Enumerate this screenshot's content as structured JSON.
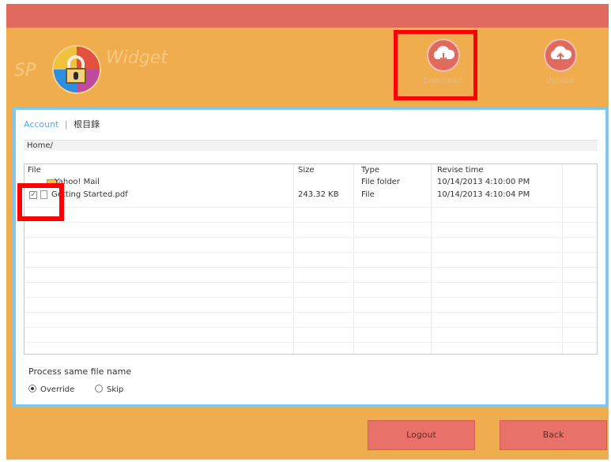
{
  "app": {
    "logo_left": "SP",
    "logo_right": "Widget"
  },
  "toolbar": {
    "download_label": "Download",
    "upload_label": "Upload"
  },
  "breadcrumb": {
    "root": "Account",
    "separator": "|",
    "current": "根目錄"
  },
  "path": "Home/",
  "table": {
    "columns": [
      "File",
      "Size",
      "Type",
      "Revise time"
    ],
    "rows": [
      {
        "name": "Yahoo! Mail",
        "size": "",
        "type": "File folder",
        "revise_time": "10/14/2013 4:10:00 PM",
        "checked": false,
        "icon": "folder-icon"
      },
      {
        "name": "Getting Started.pdf",
        "size": "243.32 KB",
        "type": "File",
        "revise_time": "10/14/2013 4:10:04 PM",
        "checked": true,
        "icon": "file-icon"
      }
    ]
  },
  "process": {
    "title": "Process same file name",
    "options": [
      {
        "label": "Override",
        "selected": true
      },
      {
        "label": "Skip",
        "selected": false
      }
    ]
  },
  "buttons": {
    "logout": "Logout",
    "back": "Back"
  },
  "colors": {
    "window_bg": "#f0ad4e",
    "titlebar": "#e06a5e",
    "panel_border": "#7fc7ee",
    "highlight": "#ff0000",
    "button": "#e8716a"
  }
}
